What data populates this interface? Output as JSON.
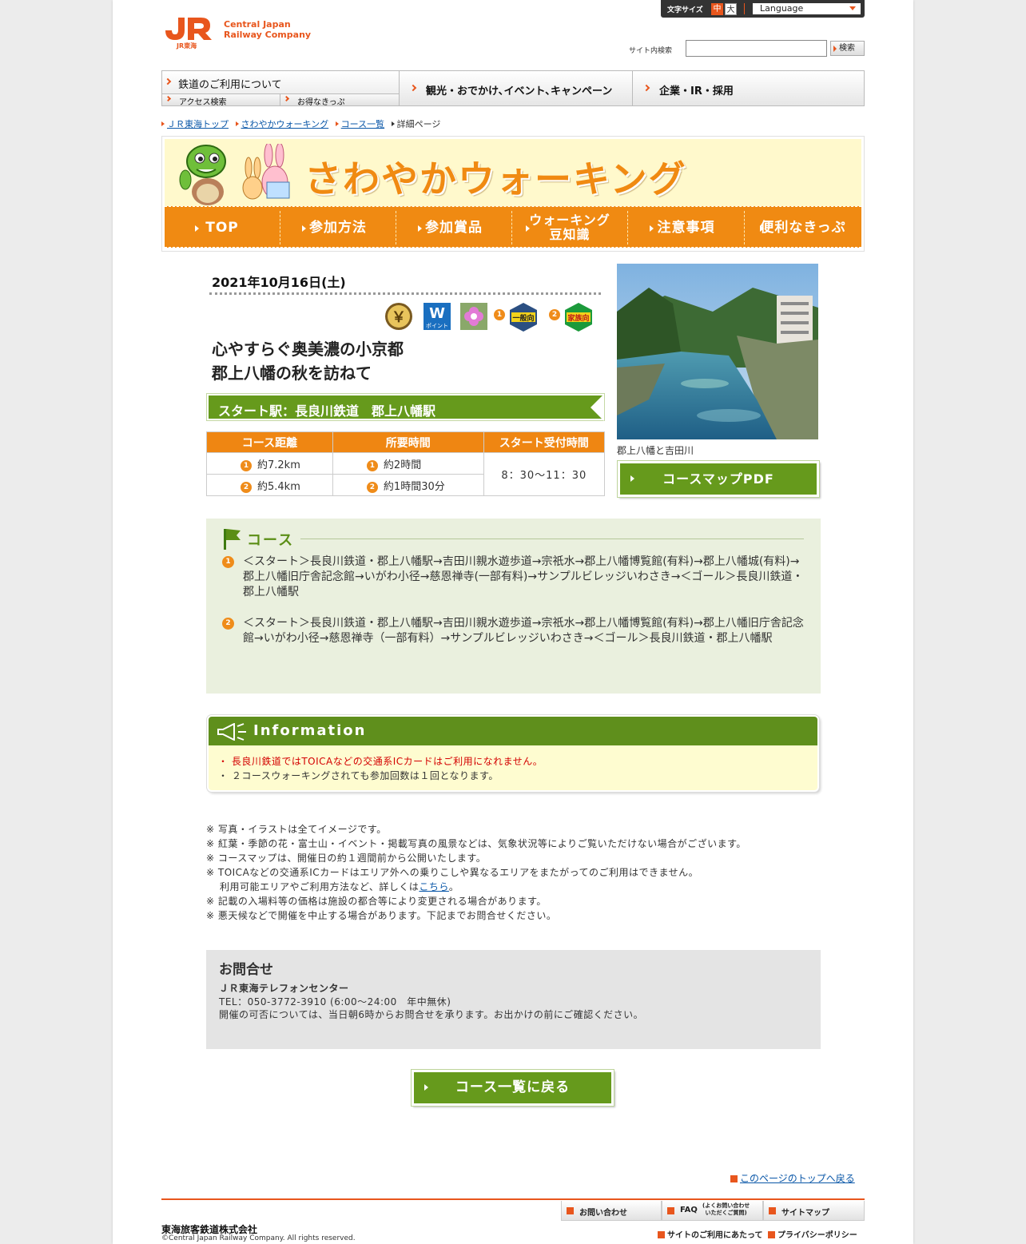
{
  "header": {
    "logo_text_line1": "Central Japan",
    "logo_text_line2": "Railway Company",
    "logo_sub": "JR東海",
    "text_size_label": "文字サイズ",
    "text_size_medium": "中",
    "text_size_large": "大",
    "language_label": "Language",
    "search_label": "サイト内検索",
    "search_value": "",
    "search_button": "検索"
  },
  "global_nav": {
    "railway": "鉄道のご利用について",
    "access": "アクセス検索",
    "tickets": "お得なきっぷ",
    "tourism": "観光・おでかけ､イベント､キャンペーン",
    "corporate": "企業・IR・採用"
  },
  "breadcrumb": [
    "ＪＲ東海トップ",
    "さわやかウォーキング",
    "コース一覧",
    "詳細ページ"
  ],
  "banner": {
    "title": "さわやかウォーキング",
    "nav": [
      "TOP",
      "参加方法",
      "参加賞品",
      "ウォーキング",
      "豆知識",
      "注意事項",
      "便利なきっぷ"
    ]
  },
  "event": {
    "date": "2021年10月16日(土)",
    "icon_labels": {
      "yen": "￥",
      "w_letter": "W",
      "w_point": "ポイント",
      "general": "一般向",
      "family": "家族向",
      "n1": "1",
      "n2": "2"
    },
    "title_line1": "心やすらぐ奥美濃の小京都",
    "title_line2": "郡上八幡の秋を訪ねて",
    "start_station": "スタート駅：長良川鉄道　郡上八幡駅",
    "table": {
      "headers": [
        "コース距離",
        "所要時間",
        "スタート受付時間"
      ],
      "rows": [
        {
          "n": "1",
          "distance": "約7.2km",
          "duration": "約2時間"
        },
        {
          "n": "2",
          "distance": "約5.4km",
          "duration": "約1時間30分"
        }
      ],
      "reception": "8：30～11：30"
    },
    "photo_caption": "郡上八幡と吉田川",
    "pdf_button": "コースマップPDF"
  },
  "course": {
    "heading": "コース",
    "routes": [
      {
        "n": "1",
        "text": "＜スタート＞長良川鉄道・郡上八幡駅→吉田川親水遊歩道→宗祇水→郡上八幡博覧館(有料)→郡上八幡城(有料)→郡上八幡旧庁舎記念館→いがわ小径→慈恩禅寺(一部有料)→サンプルビレッジいわさき→＜ゴール＞長良川鉄道・郡上八幡駅"
      },
      {
        "n": "2",
        "text": "＜スタート＞長良川鉄道・郡上八幡駅→吉田川親水遊歩道→宗祇水→郡上八幡博覧館(有料)→郡上八幡旧庁舎記念館→いがわ小径→慈恩禅寺（一部有料）→サンプルビレッジいわさき→＜ゴール＞長良川鉄道・郡上八幡駅"
      }
    ]
  },
  "information": {
    "heading": "Information",
    "items": [
      {
        "text": "・ 長良川鉄道ではTOICAなどの交通系ICカードはご利用になれません。",
        "color": "#d40000"
      },
      {
        "text": "・ ２コースウォーキングされても参加回数は１回となります。",
        "color": "#333333"
      }
    ]
  },
  "notes": {
    "n1": "※ 写真・イラストは全てイメージです。",
    "n2": "※ 紅葉・季節の花・富士山・イベント・掲載写真の風景などは、気象状況等によりご覧いただけない場合がございます。",
    "n3": "※ コースマップは、開催日の約１週間前から公開いたします。",
    "n4": "※ TOICAなどの交通系ICカードはエリア外への乗りこしや異なるエリアをまたがってのご利用はできません。",
    "n5_prefix": "利用可能エリアやご利用方法など、詳しくは",
    "n5_link": "こちら",
    "n5_suffix": "。",
    "n6": "※ 記載の入場料等の価格は施設の都合等により変更される場合があります。",
    "n7": "※ 悪天候などで開催を中止する場合があります。下記までお問合せください。"
  },
  "contact": {
    "heading": "お問合せ",
    "center": "ＪＲ東海テレフォンセンター",
    "tel": "TEL：050-3772-3910 (6:00～24:00　年中無休)",
    "note": "開催の可否については、当日朝6時からお問合せを承ります。お出かけの前にご確認ください。"
  },
  "back_button": "コース一覧に戻る",
  "footer": {
    "page_top": "このページのトップへ戻る",
    "inquiry": "お問い合わせ",
    "faq": "FAQ",
    "faq_sub1": "(よくお問い合わせ",
    "faq_sub2": "いただくご質問)",
    "sitemap": "サイトマップ",
    "terms": "サイトのご利用にあたって",
    "privacy": "プライバシーポリシー",
    "company": "東海旅客鉄道株式会社",
    "copyright": "©Central Japan Railway Company.  All rights reserved."
  },
  "colors": {
    "jr_orange": "#e8561d",
    "walking_orange": "#f08a12",
    "green": "#669a1c",
    "link_blue": "#0a57a8"
  }
}
